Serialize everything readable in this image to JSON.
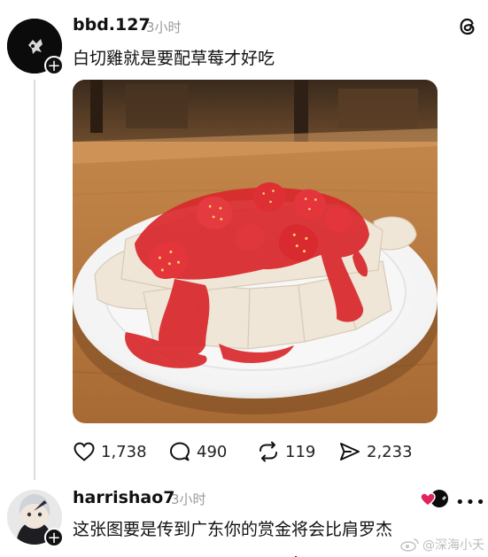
{
  "post1": {
    "username": "bbd.127",
    "time": "3小时",
    "text": "白切雞就是要配草莓才好吃",
    "actions": {
      "likes": "1,738",
      "comments": "490",
      "reposts": "119",
      "shares": "2,233"
    }
  },
  "post2": {
    "username": "harrishao7",
    "time": "3小时",
    "text": "这张图要是传到广东你的赏金将会比肩罗杰"
  },
  "watermark": "@深海小夭",
  "colors": {
    "text": "#111111",
    "muted": "#9a9a9a",
    "heart_badge": "#e0245e",
    "table_wood": "#b97a3c"
  }
}
